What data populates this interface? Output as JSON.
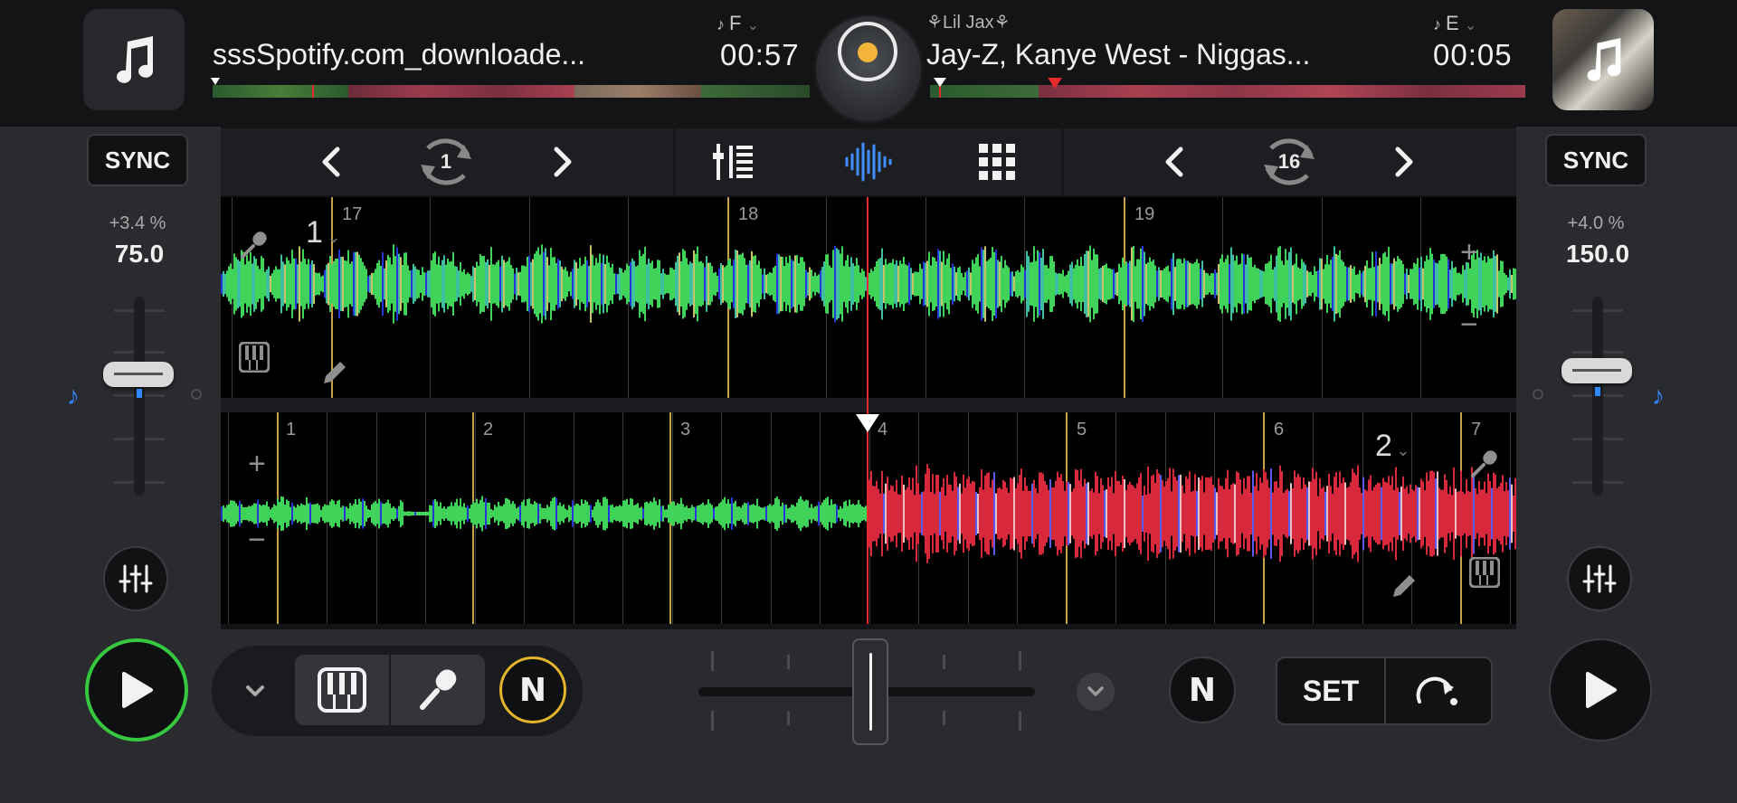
{
  "deck1": {
    "title": "sssSpotify.com_downloade...",
    "key": "F",
    "time": "00:57",
    "pitch": "+3.4 %",
    "bpm": "75.0",
    "sync_label": "SYNC",
    "deck_number": "1",
    "loop_size": "1",
    "beat_markers": [
      "17",
      "18",
      "19"
    ]
  },
  "deck2": {
    "artist": "Lil Jax",
    "title": "Jay-Z, Kanye West - Niggas...",
    "key": "E",
    "time": "00:05",
    "pitch": "+4.0 %",
    "bpm": "150.0",
    "sync_label": "SYNC",
    "deck_number": "2",
    "loop_size": "16",
    "beat_markers": [
      "1",
      "2",
      "3",
      "4",
      "5",
      "6",
      "7"
    ]
  },
  "bottom": {
    "set_label": "SET",
    "n_label": "N"
  },
  "colors": {
    "accent_blue": "#2f88ff",
    "play_ring_green": "#36c93f",
    "n_ring_yellow": "#e3b52c",
    "playhead_red": "#e52b2b",
    "downbeat_gold": "#c8a24a"
  },
  "icons": [
    "music-note-icon",
    "chevron-left-icon",
    "chevron-right-icon",
    "loop-icon",
    "mixer-icon",
    "waveform-icon",
    "grid-icon",
    "microphone-icon",
    "piano-icon",
    "pencil-icon",
    "plus-icon",
    "minus-icon",
    "eq-icon",
    "play-icon",
    "chevron-down-icon",
    "jump-icon"
  ]
}
